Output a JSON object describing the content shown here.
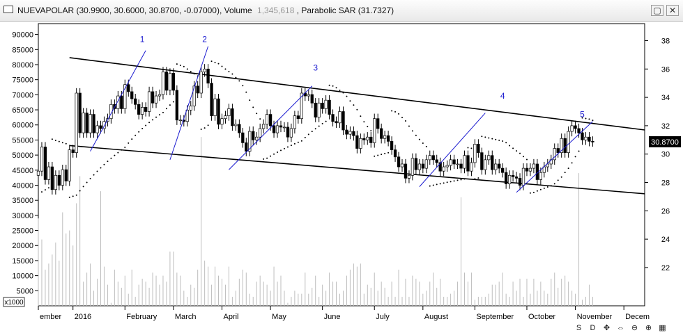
{
  "window": {
    "title_main": "NUEVAPOLAR (30.9900, 30.6000, 30.8700, -0.07000), Volume",
    "title_volume_value": "1,345,618",
    "title_sar": ", Parabolic SAR (31.7327)",
    "restore_icon": "restore-icon",
    "close_icon": "close-icon"
  },
  "chart_data": {
    "type": "candlestick",
    "symbol": "NUEVAPOLAR",
    "ohlc_last": {
      "open": 30.99,
      "high": 30.6,
      "low": 30.87,
      "change": -0.07
    },
    "last_price_label": "30.8700",
    "price_axis": {
      "side": "right",
      "ylim": [
        19.3,
        39.2
      ],
      "ticks": [
        38,
        36,
        34,
        32,
        30,
        28,
        26,
        24,
        22
      ]
    },
    "volume_axis": {
      "side": "left",
      "ylim": [
        0,
        93600
      ],
      "ticks": [
        90000,
        85000,
        80000,
        75000,
        70000,
        65000,
        60000,
        55000,
        50000,
        45000,
        40000,
        35000,
        30000,
        25000,
        20000,
        15000,
        10000,
        5000
      ],
      "multiplier_label": "x1000"
    },
    "x_axis": {
      "range": [
        0,
        175
      ],
      "labels": [
        {
          "x": 0,
          "text": "ember"
        },
        {
          "x": 10,
          "text": "2016"
        },
        {
          "x": 25,
          "text": "February"
        },
        {
          "x": 39,
          "text": "March"
        },
        {
          "x": 53,
          "text": "April"
        },
        {
          "x": 67,
          "text": "May"
        },
        {
          "x": 82,
          "text": "June"
        },
        {
          "x": 97,
          "text": "July"
        },
        {
          "x": 111,
          "text": "August"
        },
        {
          "x": 126,
          "text": "September"
        },
        {
          "x": 141,
          "text": "October"
        },
        {
          "x": 155,
          "text": "November"
        },
        {
          "x": 169,
          "text": "Decem"
        }
      ]
    },
    "close_series": [
      28.8,
      30.5,
      28.2,
      29.1,
      27.5,
      28.5,
      27.8,
      28.9,
      28.1,
      30.3,
      30.1,
      34.3,
      31.5,
      32.9,
      31.5,
      32.8,
      31.5,
      32.0,
      31.8,
      32.3,
      32.5,
      33.5,
      33.2,
      34.1,
      33.2,
      34.9,
      34.4,
      33.9,
      33.5,
      32.8,
      33.3,
      33.0,
      34.4,
      33.6,
      34.1,
      34.2,
      35.8,
      34.5,
      35.7,
      34.5,
      32.4,
      32.4,
      32.3,
      33.1,
      33.4,
      34.8,
      34.3,
      35.8,
      36.0,
      35.0,
      32.7,
      33.9,
      32.1,
      32.5,
      32.7,
      33.2,
      32.0,
      32.1,
      31.5,
      30.8,
      30.2,
      31.6,
      31.0,
      31.2,
      31.8,
      32.1,
      32.8,
      32.0,
      31.5,
      32.0,
      31.9,
      31.9,
      31.2,
      31.8,
      32.7,
      32.5,
      34.3,
      34.1,
      34.2,
      33.6,
      32.6,
      33.6,
      33.2,
      33.8,
      32.8,
      32.3,
      32.2,
      33.0,
      31.7,
      31.4,
      31.6,
      31.3,
      30.4,
      31.1,
      31.0,
      31.2,
      30.8,
      32.5,
      31.8,
      31.1,
      31.3,
      30.9,
      30.3,
      29.8,
      29.1,
      29.3,
      28.3,
      28.5,
      29.7,
      28.9,
      29.3,
      29.0,
      29.6,
      29.9,
      29.6,
      29.4,
      28.8,
      29.1,
      29.2,
      29.6,
      29.3,
      29.3,
      29.0,
      29.9,
      28.8,
      29.4,
      30.7,
      30.1,
      28.9,
      29.6,
      29.9,
      28.9,
      29.3,
      29.0,
      28.7,
      27.9,
      28.5,
      28.4,
      28.3,
      27.8,
      29.0,
      28.8,
      29.0,
      29.3,
      28.2,
      28.7,
      29.1,
      29.3,
      29.6,
      30.4,
      30.1,
      31.1,
      30.1,
      31.6,
      32.0,
      31.8,
      31.5,
      31.0,
      31.2,
      30.9,
      30.87
    ],
    "volume_series": [
      29000,
      22000,
      12000,
      14000,
      17000,
      21000,
      15000,
      31000,
      24000,
      25000,
      20000,
      34000,
      43000,
      8000,
      11000,
      14000,
      5000,
      9000,
      15000,
      13000,
      7000,
      1000,
      12000,
      8000,
      6000,
      10000,
      4000,
      12000,
      3000,
      7000,
      9000,
      8000,
      6000,
      11000,
      10000,
      7000,
      10000,
      8000,
      13000,
      18000,
      11000,
      10000,
      5000,
      3000,
      7000,
      6000,
      12000,
      56000,
      15000,
      13000,
      7000,
      13000,
      10000,
      9000,
      7000,
      13000,
      3000,
      5000,
      9000,
      12000,
      11000,
      4000,
      3000,
      8000,
      10000,
      8000,
      7000,
      5000,
      10000,
      8000,
      10000,
      5000,
      1000,
      3000,
      5000,
      4000,
      4000,
      11000,
      4000,
      6000,
      10000,
      3000,
      7000,
      5000,
      11000,
      8000,
      8000,
      4000,
      5000,
      10000,
      12000,
      14000,
      13000,
      9000,
      4000,
      7000,
      6000,
      11000,
      5000,
      8000,
      6000,
      3000,
      8000,
      3000,
      12000,
      3000,
      9000,
      3000,
      10000,
      9000,
      8000,
      4000,
      5000,
      8000,
      11000,
      6000,
      9000,
      3000,
      3000,
      4000,
      5000,
      8000,
      9000,
      11000,
      8000,
      11000,
      2000,
      3000,
      3000,
      3000,
      4000,
      7000,
      7000,
      8000,
      11000,
      4000,
      3000,
      8000,
      5000,
      9000,
      3000,
      9000,
      4000,
      9000,
      5000,
      8000,
      5000,
      4000,
      9000,
      11000,
      6000,
      9000,
      10000,
      8000,
      5000,
      4000,
      4000,
      2000,
      3000,
      7000,
      3000
    ],
    "volume_spikes": [
      {
        "i": 18,
        "v": 38000
      },
      {
        "i": 38,
        "v": 18000
      },
      {
        "i": 47,
        "v": 56000
      },
      {
        "i": 68,
        "v": 13000
      },
      {
        "i": 93,
        "v": 14000
      },
      {
        "i": 122,
        "v": 36000
      },
      {
        "i": 156,
        "v": 44000
      }
    ],
    "trend_channel": {
      "upper": {
        "x1": 9,
        "y1": 36.8,
        "x2": 175,
        "y2": 31.7
      },
      "lower": {
        "x1": 9,
        "y1": 30.6,
        "x2": 175,
        "y2": 27.2
      }
    },
    "wave_labels": [
      {
        "x": 30,
        "y": 37.9,
        "text": "1"
      },
      {
        "x": 48,
        "y": 37.9,
        "text": "2"
      },
      {
        "x": 80,
        "y": 35.9,
        "text": "3"
      },
      {
        "x": 134,
        "y": 33.9,
        "text": "4"
      },
      {
        "x": 157,
        "y": 32.6,
        "text": "5"
      }
    ],
    "wave_lines": [
      {
        "x1": 15,
        "y1": 30.2,
        "x2": 31,
        "y2": 37.3
      },
      {
        "x1": 38,
        "y1": 29.6,
        "x2": 49,
        "y2": 37.6
      },
      {
        "x1": 55,
        "y1": 28.9,
        "x2": 79,
        "y2": 34.8
      },
      {
        "x1": 110,
        "y1": 27.7,
        "x2": 129,
        "y2": 32.9
      },
      {
        "x1": 138,
        "y1": 27.3,
        "x2": 160,
        "y2": 32.3
      }
    ],
    "indicators": [
      "Volume",
      "Parabolic SAR (31.7327)"
    ],
    "colors": {
      "up": "#ffffff",
      "down": "#000000",
      "wick": "#000000",
      "channel": "#000000",
      "wave": "#1a1ad0",
      "volume": "#bdbdbd",
      "sar": "#000000"
    }
  },
  "bottom_tools": [
    "S",
    "D",
    "move-icon",
    "arrows-icon",
    "zoom-out-icon",
    "zoom-in-icon",
    "chart-icon"
  ]
}
